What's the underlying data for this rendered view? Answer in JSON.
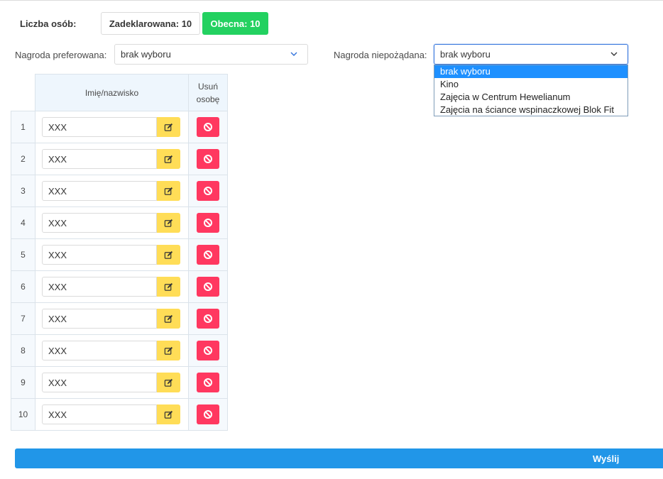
{
  "counts": {
    "label": "Liczba osób:",
    "declared": "Zadeklarowana: 10",
    "current": "Obecna: 10"
  },
  "colors": {
    "current_badge": "#23d160",
    "edit_button": "#ffdd57",
    "delete_button": "#ff3860",
    "submit": "#2196e8",
    "table_header_bg": "#eef6fd"
  },
  "preferred": {
    "label": "Nagroda preferowana:",
    "value": "brak wyboru"
  },
  "unwanted": {
    "label": "Nagroda niepożądana:",
    "value": "brak wyboru",
    "options": [
      "brak wyboru",
      "Kino",
      "Zajęcia w Centrum Hewelianum",
      "Zajęcia na ściance wspinaczkowej Blok Fit"
    ],
    "selected_index": 0
  },
  "table": {
    "col_name": "Imię/nazwisko",
    "col_delete_line1": "Usuń",
    "col_delete_line2": "osobę",
    "rows": [
      {
        "num": "1",
        "name": "XXX"
      },
      {
        "num": "2",
        "name": "XXX"
      },
      {
        "num": "3",
        "name": "XXX"
      },
      {
        "num": "4",
        "name": "XXX"
      },
      {
        "num": "5",
        "name": "XXX"
      },
      {
        "num": "6",
        "name": "XXX"
      },
      {
        "num": "7",
        "name": "XXX"
      },
      {
        "num": "8",
        "name": "XXX"
      },
      {
        "num": "9",
        "name": "XXX"
      },
      {
        "num": "10",
        "name": "XXX"
      }
    ],
    "edit_icon": "edit-icon",
    "delete_icon": "ban-icon"
  },
  "submit_label": "Wyślij"
}
